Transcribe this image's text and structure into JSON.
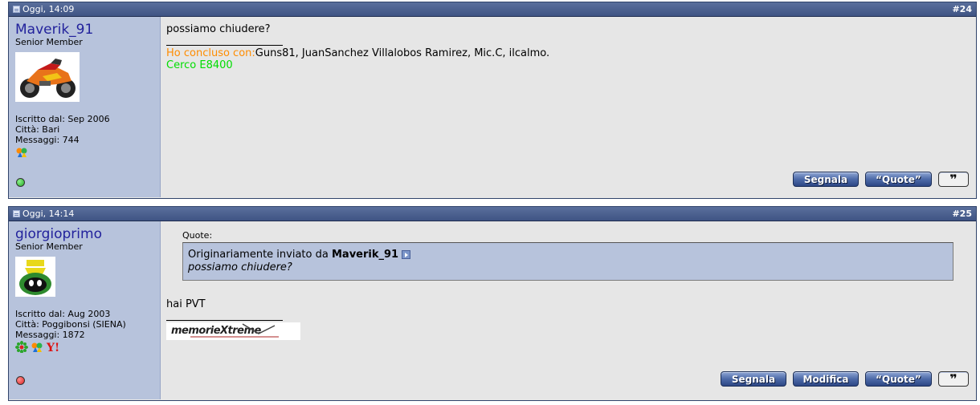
{
  "posts": [
    {
      "date": "Oggi, 14:09",
      "number": "#24",
      "username": "Maverik_91",
      "usertitle": "Senior Member",
      "joined": "Iscritto dal: Sep 2006",
      "city": "Città: Bari",
      "messages": "Messaggi: 744",
      "status_color": "#22aa22",
      "message": "possiamo chiudere?",
      "sig_label": "Ho concluso con:",
      "sig_traded": "Guns81, JuanSanchez Villalobos Ramirez, Mic.C, ilcalmo.",
      "sig_search": "Cerco E8400"
    },
    {
      "date": "Oggi, 14:14",
      "number": "#25",
      "username": "giorgioprimo",
      "usertitle": "Senior Member",
      "joined": "Iscritto dal: Aug 2003",
      "city": "Città: Poggibonsi (SIENA)",
      "messages": "Messaggi: 1872",
      "status_color": "#dd2222",
      "quote_label": "Quote:",
      "quote_intro": "Originariamente inviato da",
      "quote_author": "Maverik_91",
      "quote_text": "possiamo chiudere?",
      "message": "hai PVT",
      "sig_banner": "memorieXtreme"
    }
  ],
  "buttons": {
    "report": "Segnala",
    "edit": "Modifica",
    "quote": "“Quote”",
    "quick_reply": "❞"
  }
}
